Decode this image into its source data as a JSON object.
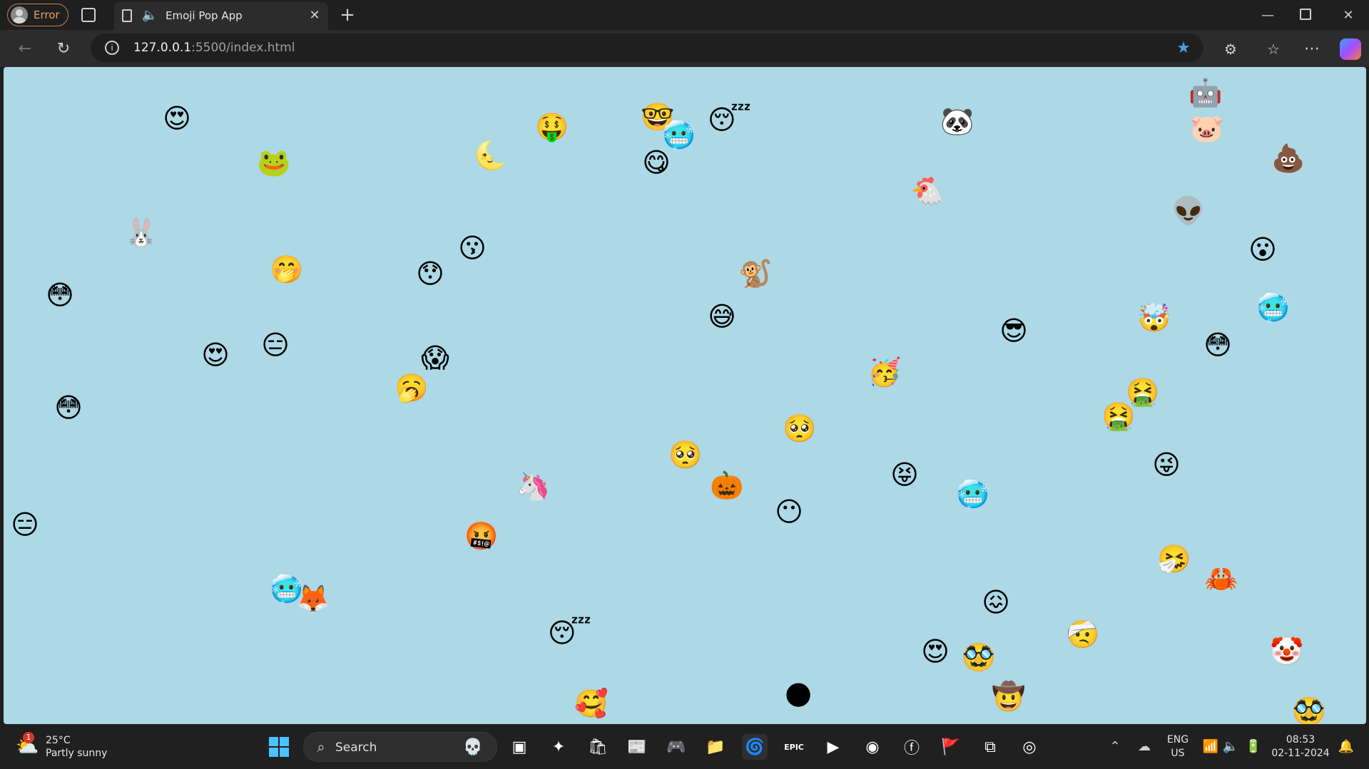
{
  "browser": {
    "profile_label": "Error",
    "tab_title": "Emoji Pop App",
    "url_host": "127.0.0.1",
    "url_path": ":5500/index.html",
    "accent_color": "#c7823d"
  },
  "page": {
    "background_color": "#add8e6",
    "emojis": [
      "😍",
      "🐸",
      "🤑",
      "🌜",
      "🤓",
      "🥶",
      "😋",
      "😴",
      "🐼",
      "🤖",
      "🐷",
      "💩",
      "🐔",
      "🐰",
      "👽",
      "😗",
      "🤭",
      "😯",
      "🐒",
      "😮",
      "😳",
      "🥶",
      "😅",
      "🤮",
      "😎",
      "🤯",
      "😍",
      "😑",
      "😱",
      "🥳",
      "🥱",
      "🤮",
      "😳",
      "😳",
      "🥺",
      "🥺",
      "😝",
      "😜",
      "🦄",
      "🎃",
      "😶",
      "🥶",
      "😑",
      "🤬",
      "🥶",
      "🦊",
      "🤧",
      "🦀",
      "😴",
      "😖",
      "🤕",
      "😍",
      "🥸",
      "🤡",
      "🥰",
      "🌑",
      "🤠",
      "🥸"
    ]
  },
  "taskbar": {
    "weather_temp": "25°C",
    "weather_desc": "Partly sunny",
    "weather_badge": "1",
    "search_label": "Search",
    "lang": "ENG",
    "region": "US",
    "time": "08:53",
    "date": "02-11-2024"
  }
}
